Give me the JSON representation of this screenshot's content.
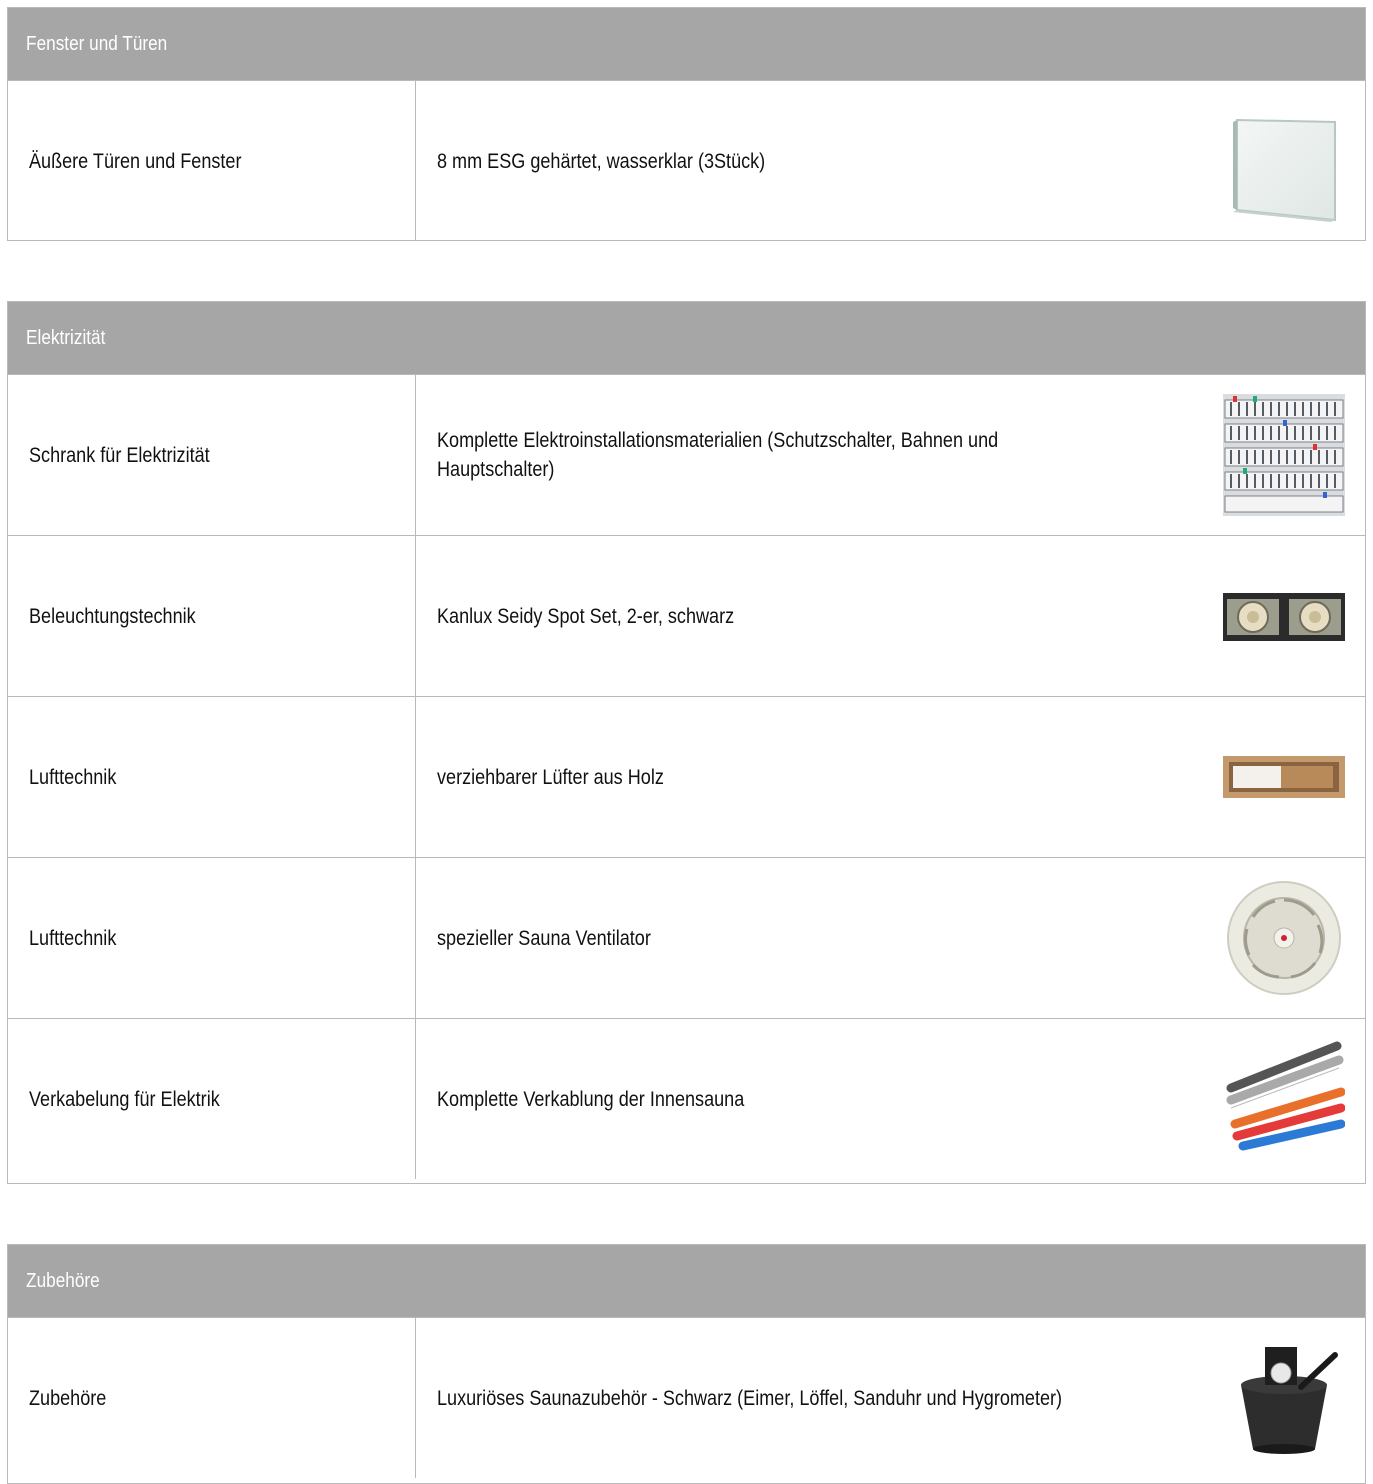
{
  "sections": [
    {
      "header": "Fenster und Türen",
      "rows": [
        {
          "name": "Äußere Türen und Fenster",
          "desc": "8 mm ESG gehärtet, wasserklar  (3Stück)",
          "icon": "glass-pane-icon"
        }
      ]
    },
    {
      "header": "Elektrizität",
      "rows": [
        {
          "name": "Schrank für Elektrizität",
          "desc": "Komplette Elektroinstallationsmaterialien (Schutzschalter, Bahnen und Hauptschalter)",
          "icon": "breaker-panel-icon"
        },
        {
          "name": "Beleuchtungstechnik",
          "desc": "Kanlux Seidy Spot Set, 2-er, schwarz",
          "icon": "spotlight-set-icon"
        },
        {
          "name": "Lufttechnik",
          "desc": "verziehbarer Lüfter aus Holz",
          "icon": "wooden-vent-icon"
        },
        {
          "name": "Lufttechnik",
          "desc": "spezieller Sauna Ventilator",
          "icon": "fan-icon"
        },
        {
          "name": "Verkabelung für Elektrik",
          "desc": "Komplette Verkablung der Innensauna",
          "icon": "cables-icon"
        }
      ]
    },
    {
      "header": "Zubehöre",
      "rows": [
        {
          "name": "Zubehöre",
          "desc": "Luxuriöses Saunazubehör - Schwarz (Eimer, Löffel, Sanduhr und Hygrometer)",
          "icon": "sauna-bucket-icon"
        }
      ]
    }
  ]
}
